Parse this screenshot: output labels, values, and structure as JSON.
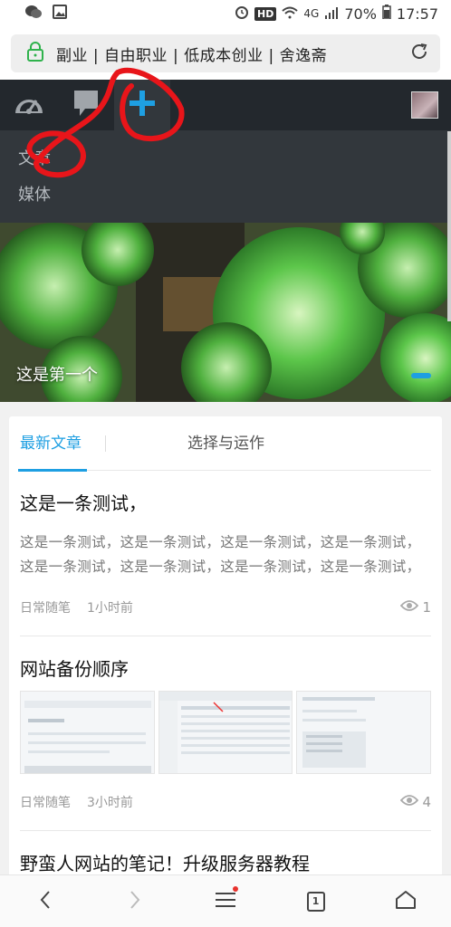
{
  "status_bar": {
    "hd": "HD",
    "network": "4G",
    "battery": "70%",
    "time": "17:57"
  },
  "url_bar": {
    "title": "副业 | 自由职业 | 低成本创业 | 舍逸斋",
    "icons": [
      "lock-icon",
      "reload-icon"
    ]
  },
  "admin_bar": {
    "items": [
      "dashboard-icon",
      "comment-icon",
      "plus-icon"
    ],
    "accent": "#1e9fe2"
  },
  "new_menu": {
    "items": [
      "文章",
      "媒体"
    ]
  },
  "hero": {
    "caption": "这是第一个"
  },
  "tabs": {
    "active": "最新文章",
    "other": "选择与运作"
  },
  "posts": [
    {
      "title": "这是一条测试，",
      "excerpt_lines": [
        "这是一条测试，这是一条测试，这是一条测试，这是一条测试，",
        "这是一条测试，这是一条测试，这是一条测试，这是一条测试，"
      ],
      "category": "日常随笔",
      "time": "1小时前",
      "views": "1"
    },
    {
      "title": "网站备份顺序",
      "category": "日常随笔",
      "time": "3小时前",
      "views": "4"
    },
    {
      "title": "野蛮人网站的笔记！升级服务器教程"
    }
  ],
  "bottom_nav": {
    "tab_count": "1",
    "icons": [
      "back-icon",
      "forward-icon",
      "menu-icon",
      "tabs-icon",
      "home-icon"
    ]
  }
}
